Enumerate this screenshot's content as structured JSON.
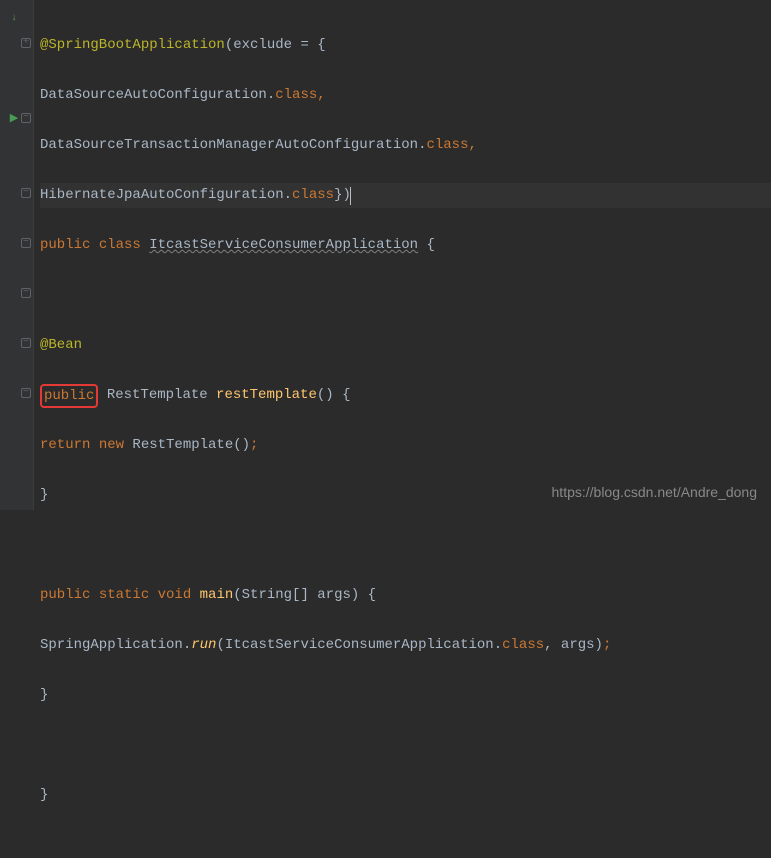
{
  "code": {
    "line1_annotation": "@SpringBootApplication",
    "line1_paren_open": "(",
    "line1_exclude": "exclude ",
    "line1_equals": "= {",
    "line2_class": "DataSourceAutoConfiguration",
    "line2_dot_class": ".",
    "line2_class_kw": "class",
    "line2_comma": ",",
    "line3_class": "DataSourceTransactionManagerAutoConfiguration",
    "line3_dot_class": ".",
    "line3_class_kw": "class",
    "line3_comma": ",",
    "line4_class": "HibernateJpaAutoConfiguration",
    "line4_dot_class": ".",
    "line4_class_kw": "class",
    "line4_close": "})",
    "line5_public": "public ",
    "line5_class_kw": "class ",
    "line5_class_name": "ItcastServiceConsumerApplication",
    "line5_brace": " {",
    "line7_bean": "@Bean",
    "line8_public": "public",
    "line8_space": " ",
    "line8_type": "RestTemplate ",
    "line8_method": "restTemplate",
    "line8_paren": "() {",
    "line9_return": "return ",
    "line9_new": "new ",
    "line9_ctor": "RestTemplate()",
    "line9_semi": ";",
    "line10_close": "}",
    "line12_public": "public ",
    "line12_static": "static ",
    "line12_void": "void ",
    "line12_main": "main",
    "line12_params": "(String[] args) {",
    "line13_springapp": "SpringApplication.",
    "line13_run": "run",
    "line13_paren_open": "(ItcastServiceConsumerApplication.",
    "line13_class_kw": "class",
    "line13_comma_args": ", args)",
    "line13_semi": ";",
    "line14_close": "}",
    "line16_close": "}"
  },
  "watermark": "https://blog.csdn.net/Andre_dong"
}
